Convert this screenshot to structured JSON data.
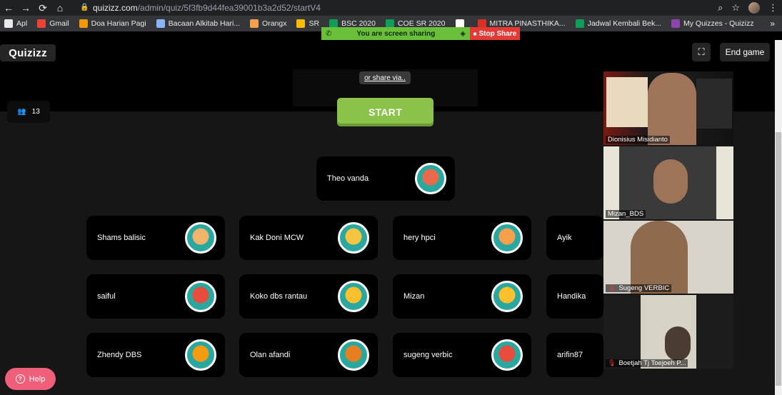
{
  "browser": {
    "url_host": "quizizz.com",
    "url_path": "/admin/quiz/5f3fb9d44fea39001b3a2d52/startV4",
    "bookmarks": [
      {
        "label": "Apl",
        "color": "#e8eaed"
      },
      {
        "label": "Gmail",
        "color": "#ea4335"
      },
      {
        "label": "Doa Harian Pagi",
        "color": "#f29900"
      },
      {
        "label": "Bacaan Alkitab Hari...",
        "color": "#8ab4f8"
      },
      {
        "label": "Orangx",
        "color": "#f6a04d"
      },
      {
        "label": "SR",
        "color": "#fbbc04"
      },
      {
        "label": "BSC 2020",
        "color": "#0f9d58"
      },
      {
        "label": "COE SR 2020",
        "color": "#0f9d58"
      },
      {
        "label": "",
        "color": "#ffffff"
      },
      {
        "label": "MITRA PINASTHIKA...",
        "color": "#d93025"
      },
      {
        "label": "Jadwal Kembali Bek...",
        "color": "#0f9d58"
      },
      {
        "label": "My Quizzes - Quizizz",
        "color": "#8e44ad"
      }
    ],
    "bookmarks_more": "»"
  },
  "share_bar": {
    "message": "You are screen sharing",
    "stop_label": "Stop Share"
  },
  "app": {
    "logo": "Quizizz",
    "fullscreen_icon": "⛶",
    "end_game_label": "End game",
    "share_via_label": "or share via..",
    "start_label": "START",
    "player_count": "13",
    "help_label": "Help"
  },
  "players": [
    {
      "name": "Theo vanda",
      "avatar": "#e86a4a"
    },
    {
      "name": "Shams balisic",
      "avatar": "#f0b46a"
    },
    {
      "name": "Kak Doni MCW",
      "avatar": "#f5c542"
    },
    {
      "name": "hery hpci",
      "avatar": "#f6a04d"
    },
    {
      "name": "Ayik",
      "avatar": "#9b59b6"
    },
    {
      "name": "saiful",
      "avatar": "#e74c3c"
    },
    {
      "name": "Koko dbs rantau",
      "avatar": "#fbc02d"
    },
    {
      "name": "Mizan",
      "avatar": "#fbc02d"
    },
    {
      "name": "Handika",
      "avatar": "#3498db"
    },
    {
      "name": "Zhendy DBS",
      "avatar": "#f39c12"
    },
    {
      "name": "Olan afandi",
      "avatar": "#e67e22"
    },
    {
      "name": "sugeng verbic",
      "avatar": "#e74c3c"
    },
    {
      "name": "arifin87",
      "avatar": "#2ecc71"
    }
  ],
  "participants": [
    {
      "name": "Dionisius Misidianto",
      "muted": false
    },
    {
      "name": "Mizan_BDS",
      "muted": false
    },
    {
      "name": "Sugeng VERBIC",
      "muted": true
    },
    {
      "name": "Boetjah Tj Toejoeh P...",
      "muted": true
    }
  ]
}
